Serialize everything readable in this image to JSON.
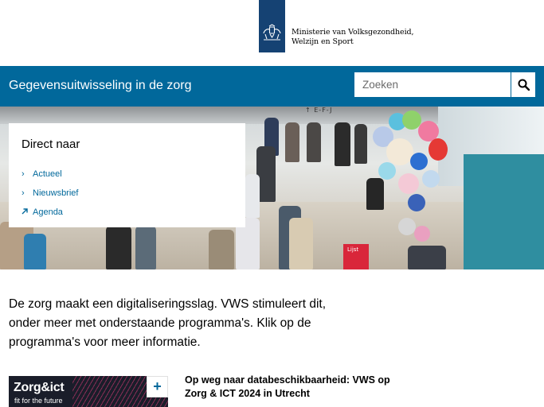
{
  "header": {
    "org_line1": "Ministerie van Volksgezondheid,",
    "org_line2": "Welzijn en Sport",
    "brand_color": "#154273"
  },
  "nav": {
    "site_title": "Gegevensuitwisseling in de zorg",
    "bar_color": "#01689b",
    "search": {
      "placeholder": "Zoeken",
      "button_icon": "search-icon"
    }
  },
  "hero": {
    "sign_text": "↑ E-F-J",
    "bag_text": "Lijst"
  },
  "direct": {
    "title": "Direct naar",
    "links": [
      {
        "label": "Actueel",
        "icon": "chevron-right-icon"
      },
      {
        "label": "Nieuwsbrief",
        "icon": "chevron-right-icon"
      },
      {
        "label": "Agenda",
        "icon": "arrow-up-right-icon"
      }
    ]
  },
  "intro": {
    "text": "De zorg maakt een digitaliseringsslag. VWS stimuleert dit, onder meer met onderstaande programma's. Klik op de programma's voor meer informatie."
  },
  "card": {
    "logo": "Zorg&ict",
    "tagline": "fit for the future",
    "expand_icon": "plus-icon",
    "title": "Op weg naar databeschikbaarheid: VWS op Zorg & ICT 2024 in Utrecht"
  }
}
